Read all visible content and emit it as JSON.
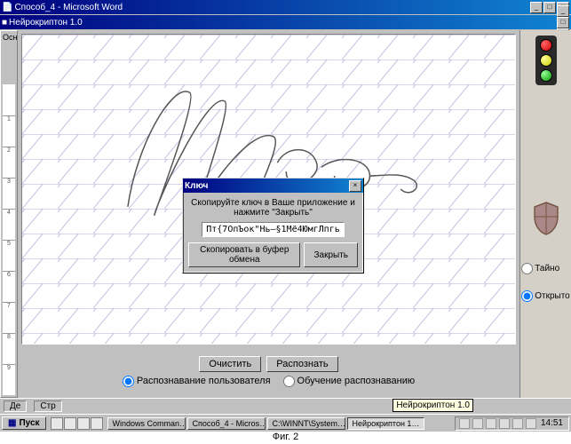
{
  "word_title": "Способ_4 - Microsoft Word",
  "app_title": "Нейрокриптон 1.0",
  "left_label_top": "Осн",
  "left_ruler_marks": [
    "1",
    "2",
    "3",
    "4",
    "5",
    "6",
    "7",
    "8",
    "9"
  ],
  "dialog": {
    "title": "Ключ",
    "message": "Скопируйте ключ в Ваше приложение и нажмите \"Закрыть\"",
    "key_value": "Пт{7ОпЪок\"Нь—§1Мё4ЮмгЛпгь",
    "copy_label": "Скопировать в буфер обмена",
    "close_label": "Закрыть"
  },
  "buttons": {
    "clear": "Очистить",
    "recognize": "Распознать"
  },
  "mode_radios": {
    "recognition": "Распознавание пользователя",
    "training": "Обучение распознаванию"
  },
  "side_radios": {
    "secret": "Тайно",
    "open": "Открыто"
  },
  "status": {
    "de": "Де",
    "str": "Стр"
  },
  "taskbar": {
    "start": "Пуск",
    "items": [
      "Windows Comman…",
      "Способ_4 - Micros…",
      "C:\\WINNT\\System…",
      "Нейрокриптон 1…"
    ],
    "tooltip": "Нейрокриптон 1.0",
    "clock": "14:51"
  },
  "caption": "Фиг. 2"
}
